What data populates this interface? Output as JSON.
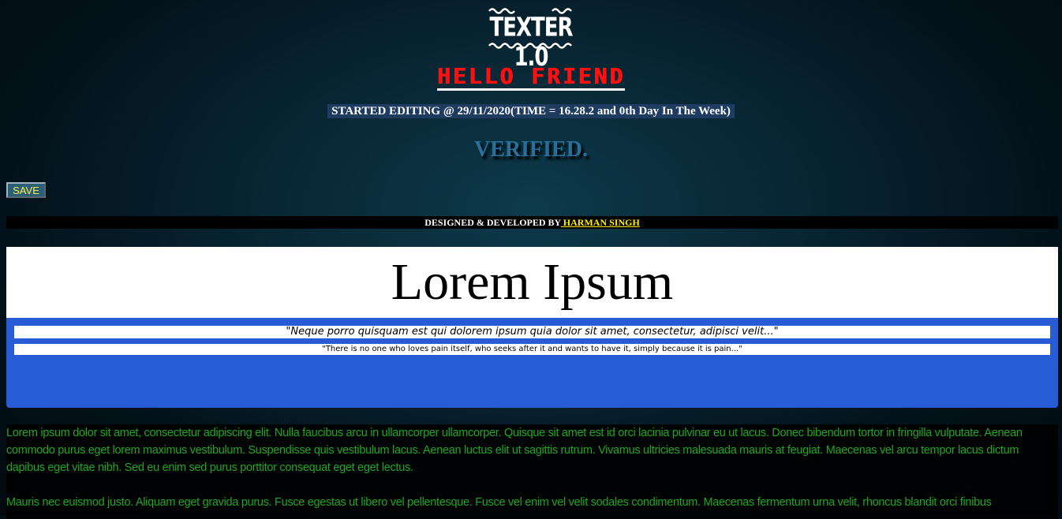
{
  "logo": {
    "text": "TEXTER 1.0"
  },
  "greeting": "HELLO FRIEND",
  "started_editing": "STARTED EDITING @ 29/11/2020(TIME = 16.28.2 and 0th Day In The Week)",
  "status": "VERIFIED.",
  "toolbar": {
    "save_label": "SAVE"
  },
  "credits": {
    "prefix": "DESIGNED & DEVELOPED BY",
    "author": " HARMAN SINGH"
  },
  "header": {
    "title": "Lorem Ipsum",
    "quote": "\"Neque porro quisquam est qui dolorem ipsum quia dolor sit amet, consectetur, adipisci velit...\"",
    "subquote": "\"There is no one who loves pain itself, who seeks after it and wants to have it, simply because it is pain...\""
  },
  "content": {
    "paragraphs": [
      "Lorem ipsum dolor sit amet, consectetur adipiscing elit. Nulla faucibus arcu in ullamcorper ullamcorper. Quisque sit amet est id orci lacinia pulvinar eu ut lacus. Donec bibendum tortor in fringilla vulputate. Aenean commodo purus eget lorem maximus vestibulum. Suspendisse quis vestibulum lacus. Aenean luctus elit ut sagittis rutrum. Vivamus ultricies malesuada mauris at feugiat. Maecenas vel arcu tempor lacus dictum dapibus eget vitae nibh. Sed eu enim sed purus porttitor consequat eget eget lectus.",
      "Mauris nec euismod justo. Aliquam eget gravida purus. Fusce egestas ut libero vel pellentesque. Fusce vel enim vel velit sodales condimentum. Maecenas fermentum urna velit, rhoncus blandit orci finibus"
    ]
  },
  "colors": {
    "greeting": "#ff1010",
    "status": "#2a6f9a",
    "body_text": "#1fa81f",
    "blue_panel": "#285cd6",
    "link": "#ffee00"
  }
}
